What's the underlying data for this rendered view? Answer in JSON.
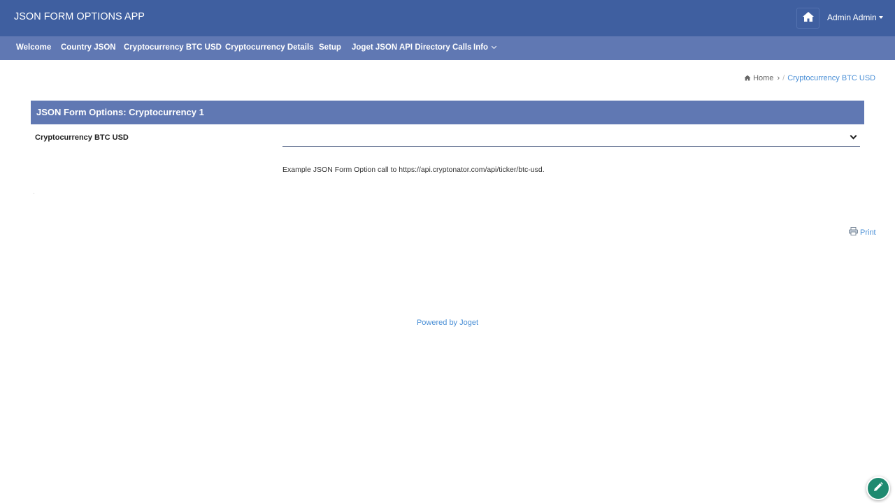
{
  "header": {
    "app_title": "JSON FORM OPTIONS APP",
    "home_icon": "home-icon",
    "user_label": "Admin Admin",
    "bg_color": "#3f5fa0"
  },
  "nav": {
    "items": [
      {
        "label": "Welcome"
      },
      {
        "label": "Country JSON"
      },
      {
        "label": "Cryptocurrency BTC USD"
      },
      {
        "label": "Cryptocurrency Details"
      },
      {
        "label": "Setup"
      },
      {
        "label": "Joget JSON API Directory Calls"
      },
      {
        "label": "Info"
      }
    ],
    "bg_color": "#6078b3"
  },
  "breadcrumb": {
    "home_label": "Home",
    "current_label": "Cryptocurrency BTC USD"
  },
  "form": {
    "title": "JSON Form Options: Cryptocurrency 1",
    "field_label": "Cryptocurrency BTC USD",
    "select_value": "",
    "description": "Example JSON Form Option call to https://api.cryptonator.com/api/ticker/btc-usd."
  },
  "actions": {
    "print_label": "Print"
  },
  "footer": {
    "powered_by": "Powered by Joget"
  },
  "colors": {
    "link": "#4a8fd6",
    "fab": "#1f8a70"
  }
}
